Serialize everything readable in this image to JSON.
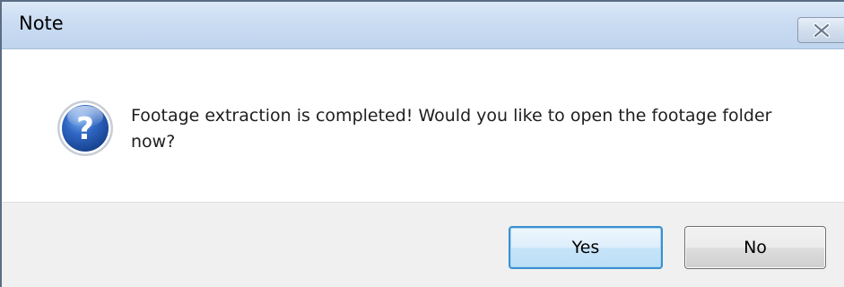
{
  "window": {
    "title": "Note"
  },
  "message": {
    "text": "Footage extraction is completed! Would you like to open the footage folder now?",
    "icon": "question-icon"
  },
  "buttons": {
    "yes_label": "Yes",
    "no_label": "No"
  },
  "colors": {
    "titlebar": "#c9dbf1",
    "footer": "#f0f0f0",
    "default_button_border": "#3c8fcf",
    "icon_blue": "#2f5fb3"
  }
}
